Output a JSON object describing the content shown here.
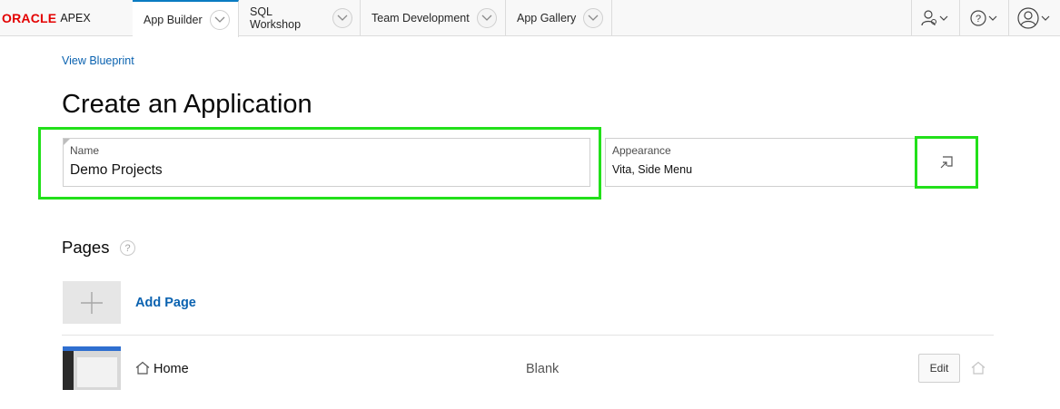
{
  "brand": {
    "oracle": "ORACLE",
    "product": "APEX",
    "oracle_color": "#e30000"
  },
  "nav": {
    "tabs": [
      {
        "label": "App Builder",
        "active": true
      },
      {
        "label": "SQL Workshop",
        "active": false
      },
      {
        "label": "Team Development",
        "active": false
      },
      {
        "label": "App Gallery",
        "active": false
      }
    ],
    "utilities": [
      "admin-user-icon",
      "help-icon",
      "account-icon"
    ]
  },
  "page": {
    "blueprint_link": "View Blueprint",
    "title": "Create an Application"
  },
  "form": {
    "name": {
      "label": "Name",
      "value": "Demo Projects"
    },
    "appearance": {
      "label": "Appearance",
      "value": "Vita, Side Menu"
    }
  },
  "pages_section": {
    "title": "Pages",
    "help": "?",
    "add_label": "Add Page",
    "rows": [
      {
        "name": "Home",
        "type": "Blank",
        "edit_label": "Edit"
      }
    ]
  },
  "colors": {
    "link": "#0a62b0",
    "highlight": "#22e01a",
    "active_tab": "#0a7cc2"
  }
}
